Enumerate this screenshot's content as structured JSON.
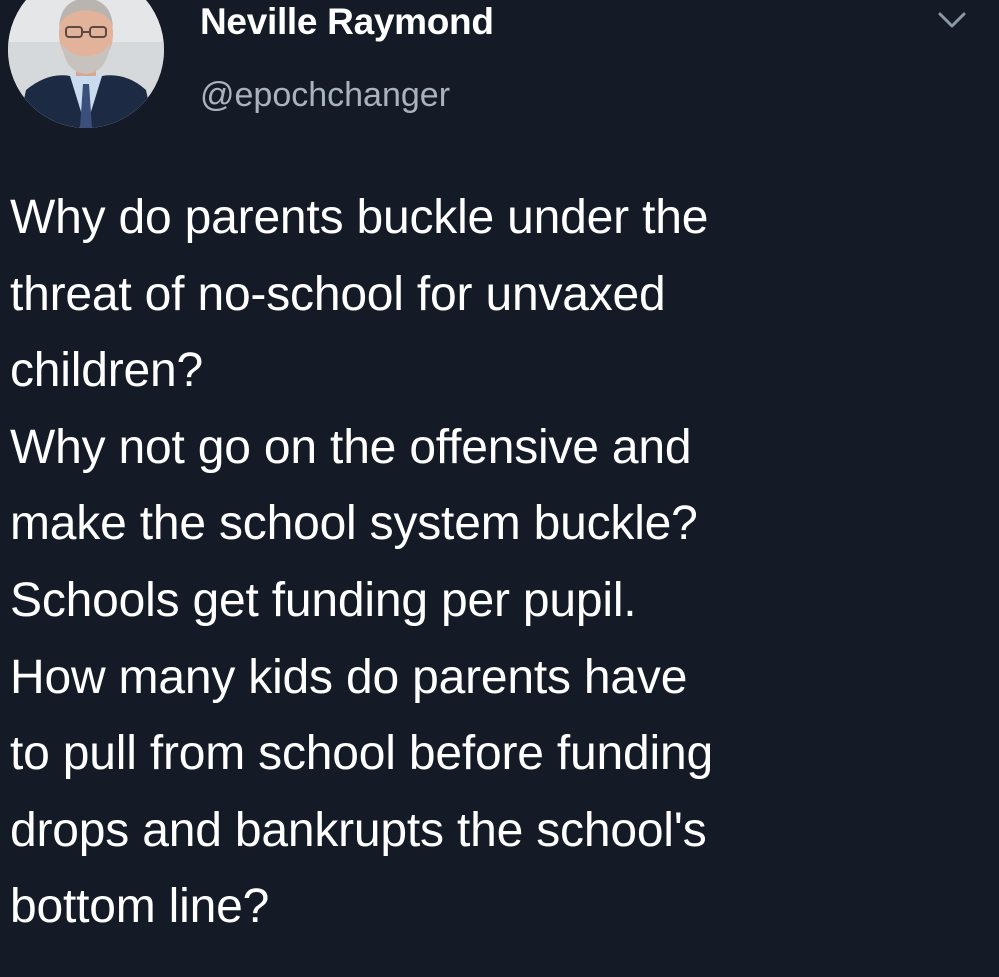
{
  "tweet": {
    "author": {
      "display_name": "Neville Raymond",
      "handle": "@epochchanger",
      "avatar_icon": "profile-photo"
    },
    "menu_icon": "chevron-down-icon",
    "body_lines": [
      "Why do parents buckle under the",
      "threat of no-school for unvaxed",
      "children?",
      "Why not go on the offensive and",
      "make the school system buckle?",
      "Schools get funding per pupil.",
      "How many kids do parents have",
      "to pull from school before funding",
      "drops and bankrupts the school's",
      "bottom line?"
    ]
  },
  "colors": {
    "background": "#141b26",
    "text": "#ffffff",
    "handle": "#a8b3bd"
  }
}
